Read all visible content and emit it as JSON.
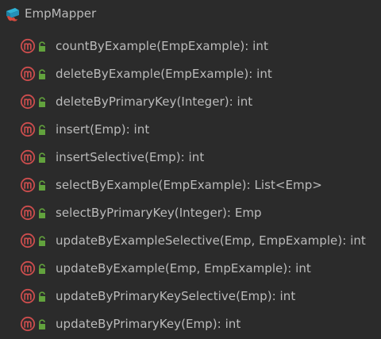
{
  "tree": {
    "root": {
      "label": "EmpMapper",
      "icon": "mapper-interface-icon"
    },
    "method_icon": "method-icon",
    "access_icon": "lock-icon",
    "colors": {
      "background": "#2b2b2b",
      "text": "#bbbbbb",
      "method_icon_red": "#cc4d4d",
      "lock_green": "#62a23d",
      "root_icon_blue": "#2fb2d6"
    },
    "methods": [
      {
        "label": "countByExample(EmpExample): int"
      },
      {
        "label": "deleteByExample(EmpExample): int"
      },
      {
        "label": "deleteByPrimaryKey(Integer): int"
      },
      {
        "label": "insert(Emp): int"
      },
      {
        "label": "insertSelective(Emp): int"
      },
      {
        "label": "selectByExample(EmpExample): List<Emp>"
      },
      {
        "label": "selectByPrimaryKey(Integer): Emp"
      },
      {
        "label": "updateByExampleSelective(Emp, EmpExample): int"
      },
      {
        "label": "updateByExample(Emp, EmpExample): int"
      },
      {
        "label": "updateByPrimaryKeySelective(Emp): int"
      },
      {
        "label": "updateByPrimaryKey(Emp): int"
      }
    ]
  }
}
